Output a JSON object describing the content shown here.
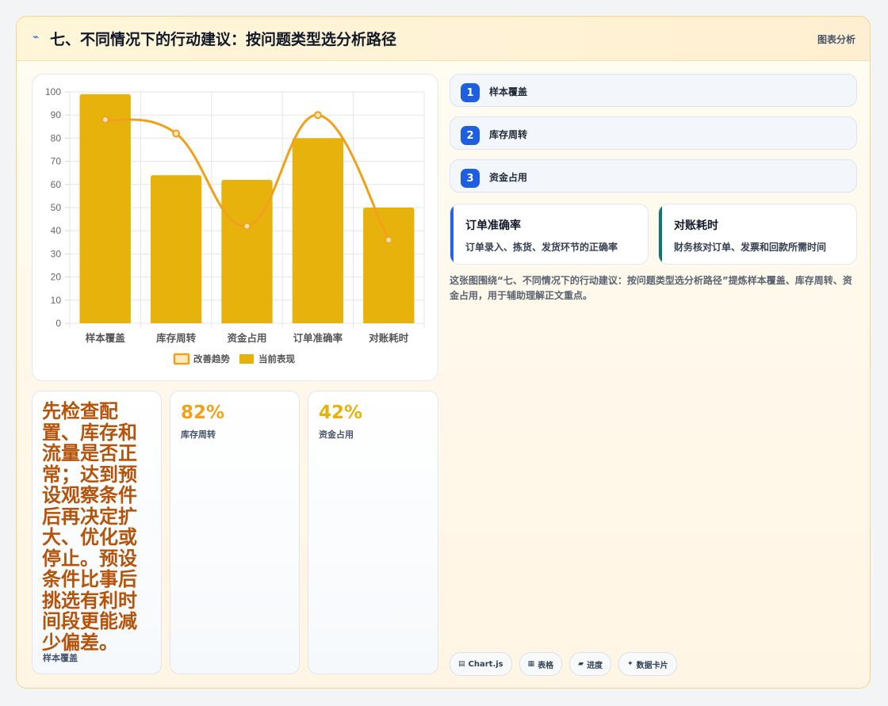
{
  "header": {
    "icon": "lightning-icon",
    "title": "七、不同情况下的行动建议：按问题类型选分析路径",
    "tag": "图表分析"
  },
  "chart_data": {
    "type": "bar",
    "categories": [
      "样本覆盖",
      "库存周转",
      "资金占用",
      "订单准确率",
      "对账耗时"
    ],
    "series": [
      {
        "name": "当前表现",
        "type": "bar",
        "values": [
          99,
          64,
          62,
          80,
          50
        ],
        "color": "#e8b20c"
      },
      {
        "name": "改善趋势",
        "type": "line",
        "values": [
          88,
          82,
          42,
          90,
          36
        ],
        "color": "#f0a11a"
      }
    ],
    "ylim": [
      0,
      100
    ],
    "yticks": [
      0,
      10,
      20,
      30,
      40,
      50,
      60,
      70,
      80,
      90,
      100
    ],
    "legend": [
      "改善趋势",
      "当前表现"
    ],
    "legend_position": "bottom",
    "grid": true
  },
  "steps": [
    {
      "num": "1",
      "label": "样本覆盖"
    },
    {
      "num": "2",
      "label": "库存周转"
    },
    {
      "num": "3",
      "label": "资金占用"
    }
  ],
  "info_cards": [
    {
      "title": "订单准确率",
      "desc": "订单录入、拣货、发货环节的正确率",
      "accent": "#2563eb"
    },
    {
      "title": "对账耗时",
      "desc": "财务核对订单、发票和回款所需时间",
      "accent": "#0f766e"
    }
  ],
  "description": "这张图围绕“七、不同情况下的行动建议：按问题类型选分析路径”提炼样本覆盖、库存周转、资金占用，用于辅助理解正文重点。",
  "stats": [
    {
      "text": "先检查配置、库存和流量是否正常；达到预设观察条件后再决定扩大、优化或停止。预设条件比事后挑选有利时间段更能减少偏差。",
      "label": "样本覆盖"
    },
    {
      "value": "82%",
      "label": "库存周转",
      "color": "#f0a11a"
    },
    {
      "value": "42%",
      "label": "资金占用",
      "color": "#e8b20c"
    }
  ],
  "chips": [
    {
      "icon": "chart-icon",
      "glyph": "▤",
      "label": "Chart.js"
    },
    {
      "icon": "table-icon",
      "glyph": "▦",
      "label": "表格"
    },
    {
      "icon": "progress-icon",
      "glyph": "▰",
      "label": "进度"
    },
    {
      "icon": "sparkle-icon",
      "glyph": "✦",
      "label": "数据卡片"
    }
  ]
}
